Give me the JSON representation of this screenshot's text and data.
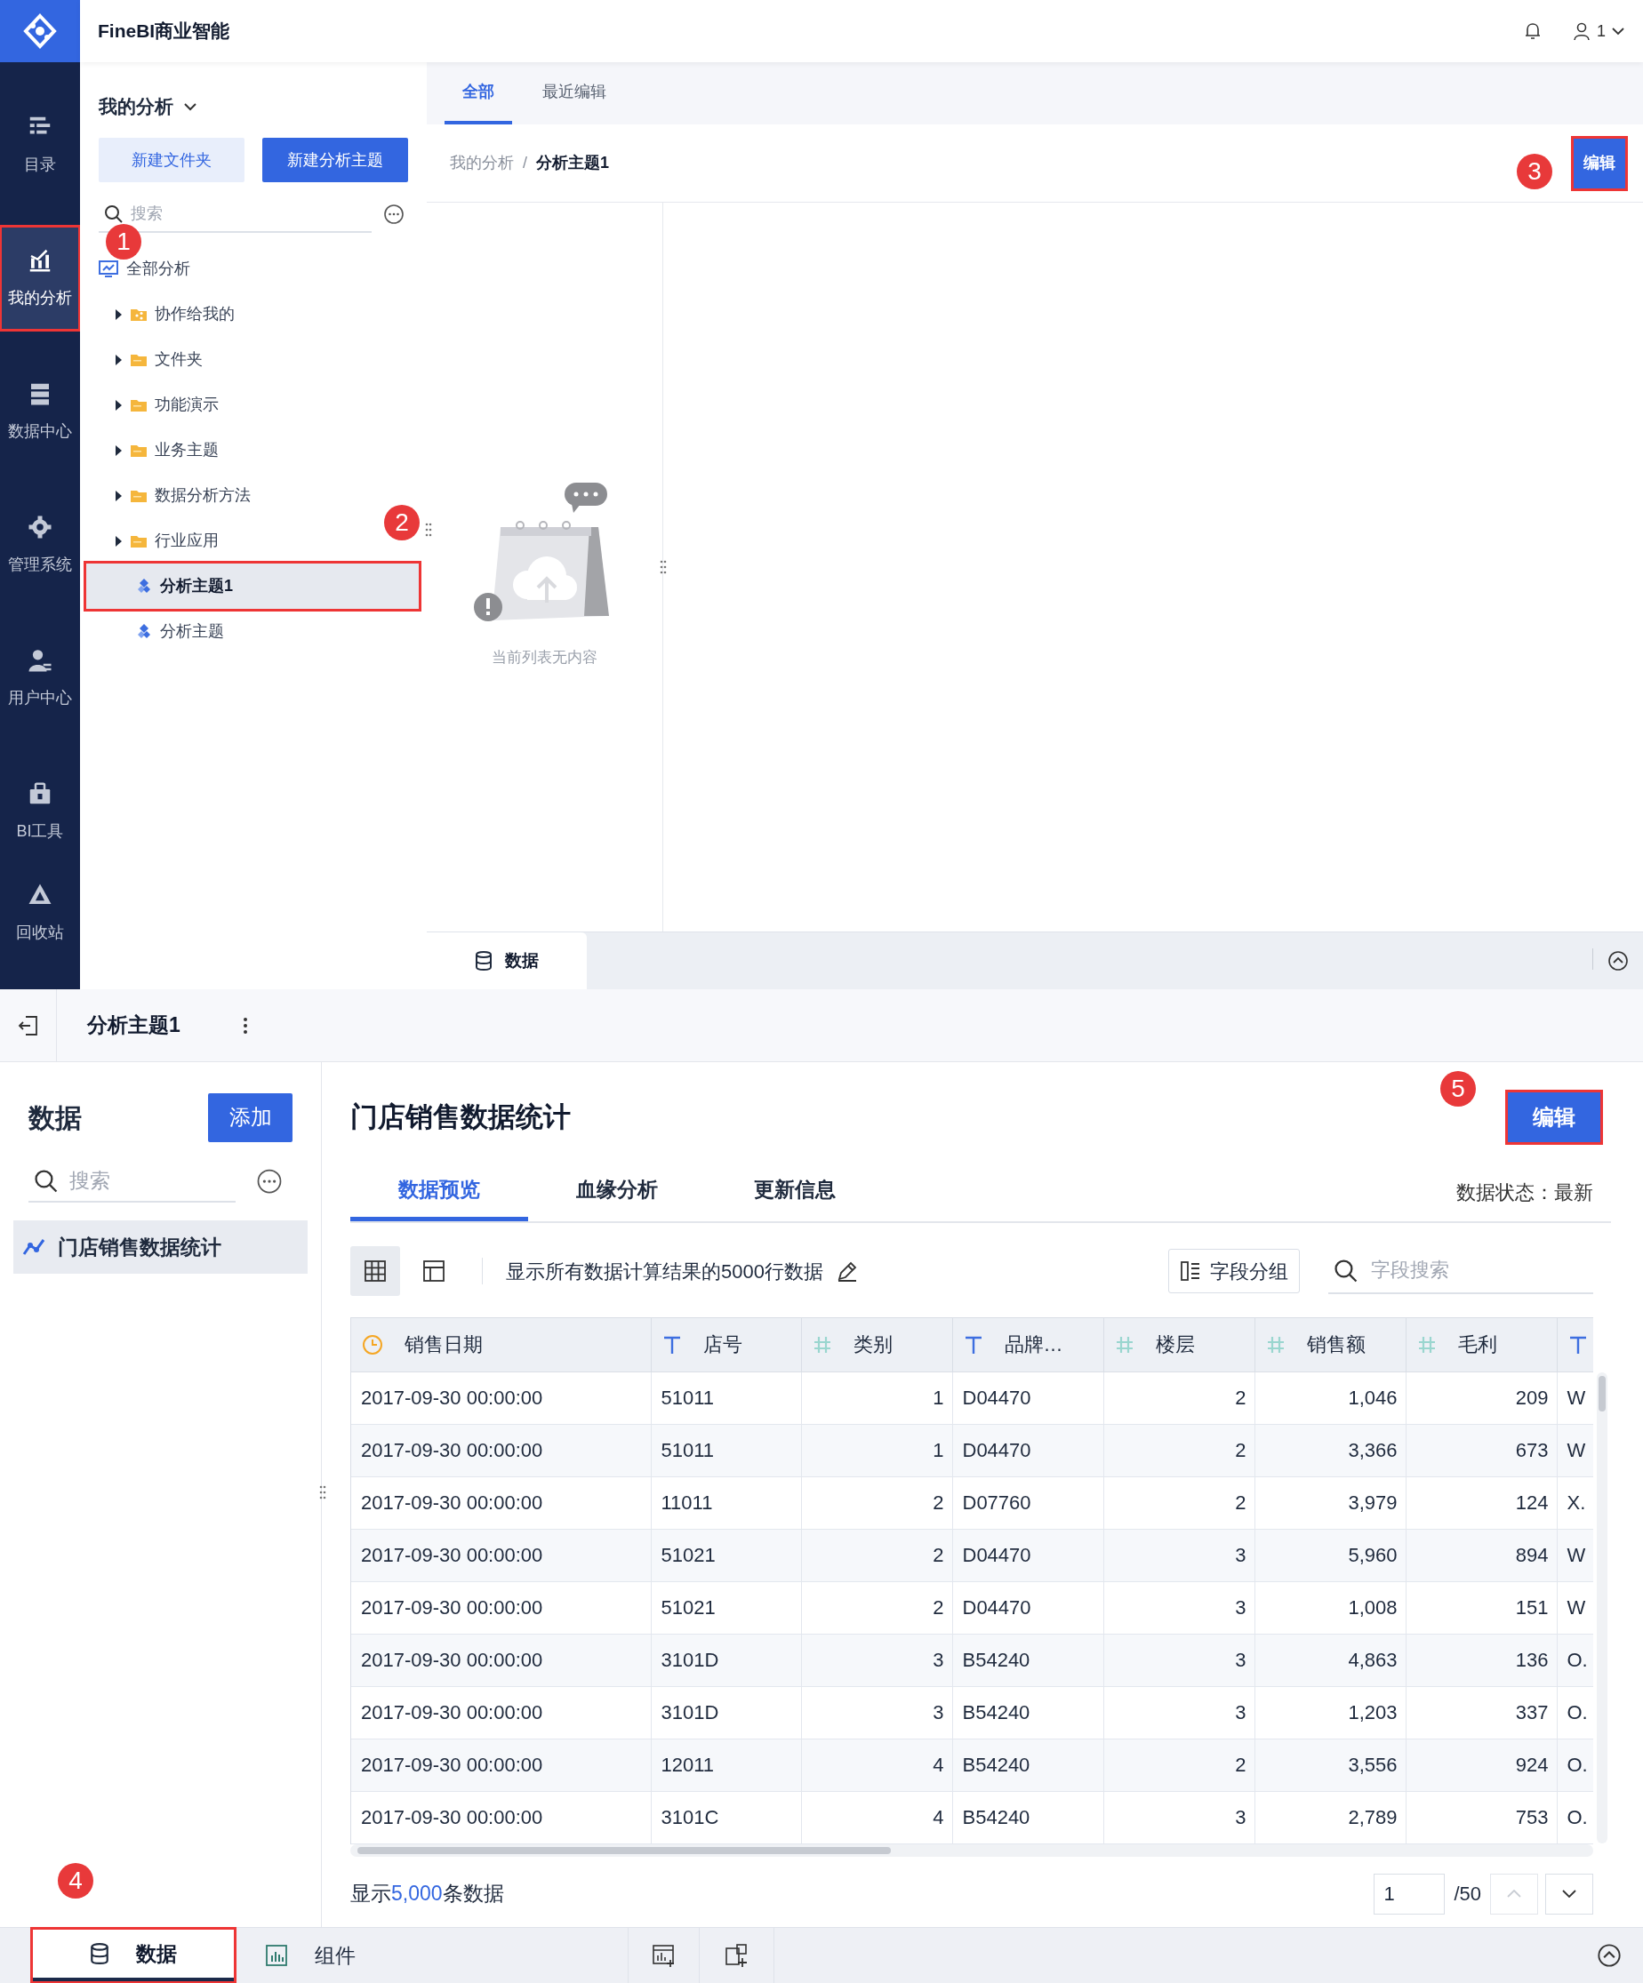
{
  "app_header": {
    "title": "FineBI商业智能",
    "user": "1"
  },
  "nav": [
    {
      "label": "目录",
      "selected": false,
      "highlighted": false
    },
    {
      "label": "我的分析",
      "selected": true,
      "highlighted": true
    },
    {
      "label": "数据中心",
      "selected": false,
      "highlighted": false
    },
    {
      "label": "管理系统",
      "selected": false,
      "highlighted": false
    },
    {
      "label": "用户中心",
      "selected": false,
      "highlighted": false
    },
    {
      "label": "BI工具",
      "selected": false,
      "highlighted": false
    },
    {
      "label": "回收站",
      "selected": false,
      "highlighted": false
    }
  ],
  "tree_panel": {
    "title": "我的分析",
    "buttons": [
      {
        "label": "新建文件夹",
        "kind": "secondary"
      },
      {
        "label": "新建分析主题",
        "kind": "primary"
      }
    ],
    "search": {
      "placeholder": "搜索"
    },
    "tree": [
      {
        "label": "全部分析",
        "kind": "root",
        "selected": false,
        "highlighted": false,
        "children": [
          {
            "label": "协作给我的",
            "kind": "shared-folder",
            "expanded": false,
            "selected": false,
            "highlighted": false
          },
          {
            "label": "文件夹",
            "kind": "folder",
            "expanded": false,
            "selected": false,
            "highlighted": false
          },
          {
            "label": "功能演示",
            "kind": "folder",
            "expanded": false,
            "selected": false,
            "highlighted": false
          },
          {
            "label": "业务主题",
            "kind": "folder",
            "expanded": false,
            "selected": false,
            "highlighted": false
          },
          {
            "label": "数据分析方法",
            "kind": "folder",
            "expanded": false,
            "selected": false,
            "highlighted": false
          },
          {
            "label": "行业应用",
            "kind": "folder",
            "expanded": false,
            "selected": false,
            "highlighted": false
          },
          {
            "label": "分析主题1",
            "kind": "theme",
            "selected": true,
            "highlighted": true
          },
          {
            "label": "分析主题",
            "kind": "theme",
            "selected": false,
            "highlighted": false
          }
        ]
      }
    ]
  },
  "content": {
    "tabs": [
      {
        "label": "全部",
        "selected": true
      },
      {
        "label": "最近编辑",
        "selected": false
      }
    ],
    "breadcrumb": {
      "parent": "我的分析",
      "separator": "/",
      "current": "分析主题1"
    },
    "edit_button": {
      "label": "编辑",
      "highlighted": true
    },
    "empty_text": "当前列表无内容",
    "bottom_tab": {
      "label": "数据",
      "selected": true
    }
  },
  "editor": {
    "header_title": "分析主题1",
    "data_panel": {
      "title": "数据",
      "add_button": "添加",
      "search": {
        "placeholder": "搜索"
      },
      "items": [
        {
          "label": "门店销售数据统计",
          "selected": true
        }
      ]
    },
    "dataset": {
      "title": "门店销售数据统计",
      "edit_button": {
        "label": "编辑",
        "highlighted": true
      },
      "tabs": [
        {
          "label": "数据预览",
          "selected": true
        },
        {
          "label": "血缘分析",
          "selected": false
        },
        {
          "label": "更新信息",
          "selected": false
        }
      ],
      "status": "数据状态：最新",
      "view_modes": [
        {
          "kind": "grid",
          "selected": true
        },
        {
          "kind": "layout",
          "selected": false
        }
      ],
      "note": "显示所有数据计算结果的5000行数据",
      "group_button": "字段分组",
      "field_search": {
        "placeholder": "字段搜索"
      },
      "table": {
        "columns": [
          {
            "label": "销售日期",
            "kind": "date"
          },
          {
            "label": "店号",
            "kind": "text"
          },
          {
            "label": "类别",
            "kind": "number"
          },
          {
            "label": "品牌…",
            "kind": "text"
          },
          {
            "label": "楼层",
            "kind": "number"
          },
          {
            "label": "销售额",
            "kind": "number"
          },
          {
            "label": "毛利",
            "kind": "number"
          },
          {
            "kind": "text"
          }
        ],
        "rows": [
          [
            "2017-09-30 00:00:00",
            "51011",
            "1",
            "D04470",
            "2",
            "1,046",
            "209",
            "W"
          ],
          [
            "2017-09-30 00:00:00",
            "51011",
            "1",
            "D04470",
            "2",
            "3,366",
            "673",
            "W"
          ],
          [
            "2017-09-30 00:00:00",
            "11011",
            "2",
            "D07760",
            "2",
            "3,979",
            "124",
            "X."
          ],
          [
            "2017-09-30 00:00:00",
            "51021",
            "2",
            "D04470",
            "3",
            "5,960",
            "894",
            "W"
          ],
          [
            "2017-09-30 00:00:00",
            "51021",
            "2",
            "D04470",
            "3",
            "1,008",
            "151",
            "W"
          ],
          [
            "2017-09-30 00:00:00",
            "3101D",
            "3",
            "B54240",
            "3",
            "4,863",
            "136",
            "O."
          ],
          [
            "2017-09-30 00:00:00",
            "3101D",
            "3",
            "B54240",
            "3",
            "1,203",
            "337",
            "O."
          ],
          [
            "2017-09-30 00:00:00",
            "12011",
            "4",
            "B54240",
            "2",
            "3,556",
            "924",
            "O."
          ],
          [
            "2017-09-30 00:00:00",
            "3101C",
            "4",
            "B54240",
            "3",
            "2,789",
            "753",
            "O."
          ]
        ]
      },
      "footer": {
        "prefix": "显示",
        "count": "5,000",
        "suffix": "条数据"
      },
      "pagination": {
        "page": "1",
        "total": "/50",
        "prev_disabled": true
      }
    },
    "bottom_tabs": [
      {
        "label": "数据",
        "selected": true,
        "highlighted": true
      },
      {
        "label": "组件",
        "selected": false,
        "highlighted": false
      }
    ]
  },
  "annotations": [
    {
      "label": "1"
    },
    {
      "label": "2"
    },
    {
      "label": "3"
    },
    {
      "label": "4"
    },
    {
      "label": "5"
    }
  ]
}
